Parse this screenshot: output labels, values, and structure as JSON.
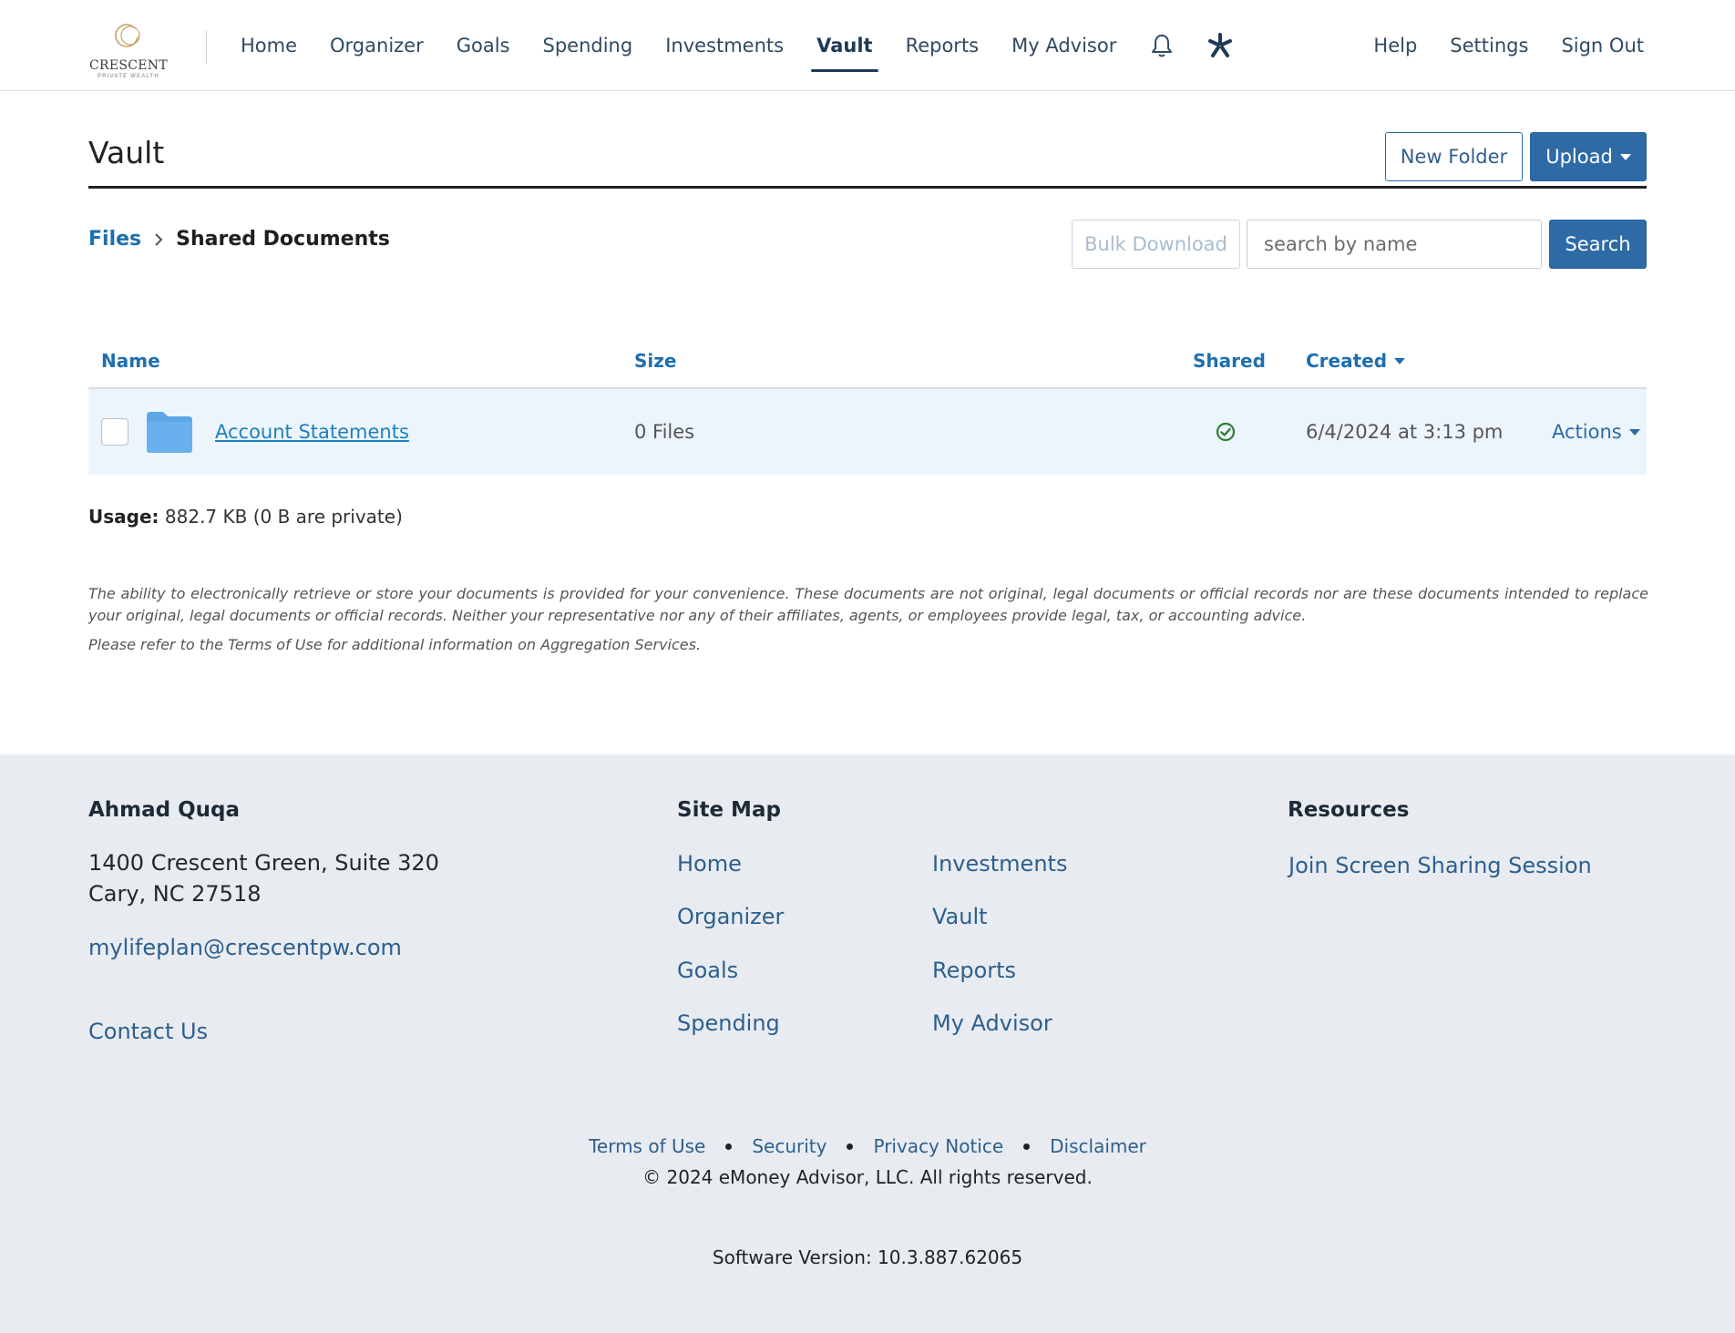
{
  "brand": {
    "logo_word": "CRESCENT",
    "logo_sub": "PRIVATE WEALTH",
    "accent": "#c9a06a"
  },
  "nav": {
    "items": [
      "Home",
      "Organizer",
      "Goals",
      "Spending",
      "Investments",
      "Vault",
      "Reports",
      "My Advisor"
    ],
    "active": "Vault",
    "icons": [
      "bell-icon",
      "asterisk-icon"
    ],
    "right": [
      "Help",
      "Settings",
      "Sign Out"
    ]
  },
  "page": {
    "title": "Vault",
    "new_folder_label": "New Folder",
    "upload_label": "Upload"
  },
  "breadcrumb": {
    "root": "Files",
    "current": "Shared Documents"
  },
  "toolbar": {
    "bulk_download_label": "Bulk Download",
    "search_placeholder": "search by name",
    "search_label": "Search"
  },
  "table": {
    "columns": {
      "name": "Name",
      "size": "Size",
      "shared": "Shared",
      "created": "Created"
    },
    "rows": [
      {
        "name": "Account Statements",
        "size": "0 Files",
        "shared": true,
        "created": "6/4/2024 at 3:13 pm",
        "actions": "Actions"
      }
    ]
  },
  "usage": {
    "label": "Usage:",
    "value": "882.7 KB (0 B are private)"
  },
  "disclaimer": {
    "main": "The ability to electronically retrieve or store your documents is provided for your convenience. These documents are not original, legal documents or official records nor are these documents intended to replace your original, legal documents or official records. Neither your representative nor any of their affiliates, agents, or employees provide legal, tax, or accounting advice.",
    "terms": "Please refer to the Terms of Use for additional information on Aggregation Services."
  },
  "footer": {
    "advisor": {
      "name": "Ahmad Quqa",
      "address1": "1400 Crescent Green, Suite 320",
      "address2": "Cary, NC 27518",
      "email": "mylifeplan@crescentpw.com",
      "contact": "Contact Us"
    },
    "sitemap": {
      "heading": "Site Map",
      "col1": [
        "Home",
        "Organizer",
        "Goals",
        "Spending"
      ],
      "col2": [
        "Investments",
        "Vault",
        "Reports",
        "My Advisor"
      ]
    },
    "resources": {
      "heading": "Resources",
      "link": "Join Screen Sharing Session"
    },
    "legal": [
      "Terms of Use",
      "Security",
      "Privacy Notice",
      "Disclaimer"
    ],
    "copyright": "© 2024 eMoney Advisor, LLC. All rights reserved.",
    "version": "Software Version: 10.3.887.62065"
  }
}
